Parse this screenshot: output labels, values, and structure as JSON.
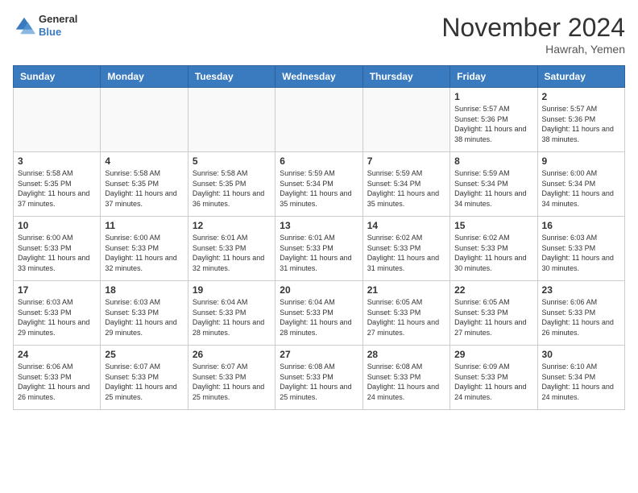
{
  "header": {
    "logo_text_top": "General",
    "logo_text_bottom": "Blue",
    "month": "November 2024",
    "location": "Hawrah, Yemen"
  },
  "days_of_week": [
    "Sunday",
    "Monday",
    "Tuesday",
    "Wednesday",
    "Thursday",
    "Friday",
    "Saturday"
  ],
  "weeks": [
    [
      {
        "day": "",
        "empty": true
      },
      {
        "day": "",
        "empty": true
      },
      {
        "day": "",
        "empty": true
      },
      {
        "day": "",
        "empty": true
      },
      {
        "day": "",
        "empty": true
      },
      {
        "day": "1",
        "sunrise": "5:57 AM",
        "sunset": "5:36 PM",
        "daylight": "11 hours and 38 minutes."
      },
      {
        "day": "2",
        "sunrise": "5:57 AM",
        "sunset": "5:36 PM",
        "daylight": "11 hours and 38 minutes."
      }
    ],
    [
      {
        "day": "3",
        "sunrise": "5:58 AM",
        "sunset": "5:35 PM",
        "daylight": "11 hours and 37 minutes."
      },
      {
        "day": "4",
        "sunrise": "5:58 AM",
        "sunset": "5:35 PM",
        "daylight": "11 hours and 37 minutes."
      },
      {
        "day": "5",
        "sunrise": "5:58 AM",
        "sunset": "5:35 PM",
        "daylight": "11 hours and 36 minutes."
      },
      {
        "day": "6",
        "sunrise": "5:59 AM",
        "sunset": "5:34 PM",
        "daylight": "11 hours and 35 minutes."
      },
      {
        "day": "7",
        "sunrise": "5:59 AM",
        "sunset": "5:34 PM",
        "daylight": "11 hours and 35 minutes."
      },
      {
        "day": "8",
        "sunrise": "5:59 AM",
        "sunset": "5:34 PM",
        "daylight": "11 hours and 34 minutes."
      },
      {
        "day": "9",
        "sunrise": "6:00 AM",
        "sunset": "5:34 PM",
        "daylight": "11 hours and 34 minutes."
      }
    ],
    [
      {
        "day": "10",
        "sunrise": "6:00 AM",
        "sunset": "5:33 PM",
        "daylight": "11 hours and 33 minutes."
      },
      {
        "day": "11",
        "sunrise": "6:00 AM",
        "sunset": "5:33 PM",
        "daylight": "11 hours and 32 minutes."
      },
      {
        "day": "12",
        "sunrise": "6:01 AM",
        "sunset": "5:33 PM",
        "daylight": "11 hours and 32 minutes."
      },
      {
        "day": "13",
        "sunrise": "6:01 AM",
        "sunset": "5:33 PM",
        "daylight": "11 hours and 31 minutes."
      },
      {
        "day": "14",
        "sunrise": "6:02 AM",
        "sunset": "5:33 PM",
        "daylight": "11 hours and 31 minutes."
      },
      {
        "day": "15",
        "sunrise": "6:02 AM",
        "sunset": "5:33 PM",
        "daylight": "11 hours and 30 minutes."
      },
      {
        "day": "16",
        "sunrise": "6:03 AM",
        "sunset": "5:33 PM",
        "daylight": "11 hours and 30 minutes."
      }
    ],
    [
      {
        "day": "17",
        "sunrise": "6:03 AM",
        "sunset": "5:33 PM",
        "daylight": "11 hours and 29 minutes."
      },
      {
        "day": "18",
        "sunrise": "6:03 AM",
        "sunset": "5:33 PM",
        "daylight": "11 hours and 29 minutes."
      },
      {
        "day": "19",
        "sunrise": "6:04 AM",
        "sunset": "5:33 PM",
        "daylight": "11 hours and 28 minutes."
      },
      {
        "day": "20",
        "sunrise": "6:04 AM",
        "sunset": "5:33 PM",
        "daylight": "11 hours and 28 minutes."
      },
      {
        "day": "21",
        "sunrise": "6:05 AM",
        "sunset": "5:33 PM",
        "daylight": "11 hours and 27 minutes."
      },
      {
        "day": "22",
        "sunrise": "6:05 AM",
        "sunset": "5:33 PM",
        "daylight": "11 hours and 27 minutes."
      },
      {
        "day": "23",
        "sunrise": "6:06 AM",
        "sunset": "5:33 PM",
        "daylight": "11 hours and 26 minutes."
      }
    ],
    [
      {
        "day": "24",
        "sunrise": "6:06 AM",
        "sunset": "5:33 PM",
        "daylight": "11 hours and 26 minutes."
      },
      {
        "day": "25",
        "sunrise": "6:07 AM",
        "sunset": "5:33 PM",
        "daylight": "11 hours and 25 minutes."
      },
      {
        "day": "26",
        "sunrise": "6:07 AM",
        "sunset": "5:33 PM",
        "daylight": "11 hours and 25 minutes."
      },
      {
        "day": "27",
        "sunrise": "6:08 AM",
        "sunset": "5:33 PM",
        "daylight": "11 hours and 25 minutes."
      },
      {
        "day": "28",
        "sunrise": "6:08 AM",
        "sunset": "5:33 PM",
        "daylight": "11 hours and 24 minutes."
      },
      {
        "day": "29",
        "sunrise": "6:09 AM",
        "sunset": "5:33 PM",
        "daylight": "11 hours and 24 minutes."
      },
      {
        "day": "30",
        "sunrise": "6:10 AM",
        "sunset": "5:34 PM",
        "daylight": "11 hours and 24 minutes."
      }
    ]
  ]
}
